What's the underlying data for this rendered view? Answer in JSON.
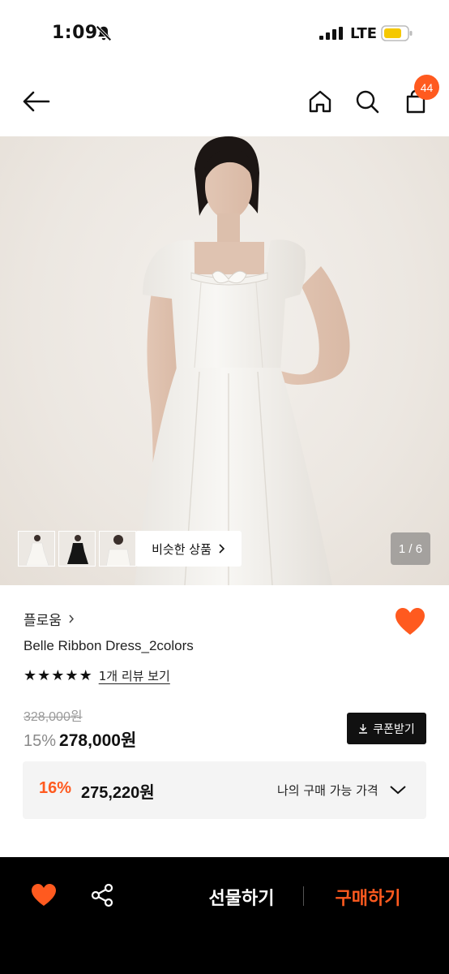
{
  "status_bar": {
    "time": "1:09",
    "network": "LTE"
  },
  "nav": {
    "cart_count": "44"
  },
  "gallery": {
    "similar_label": "비슷한 상품",
    "page_indicator": "1 / 6",
    "current_page": 1,
    "total_pages": 6
  },
  "product": {
    "brand": "플로움",
    "name": "Belle Ribbon Dress_2colors",
    "rating_stars": 5,
    "review_link": "1개 리뷰 보기",
    "original_price": "328,000원",
    "discount": "15%",
    "price": "278,000원",
    "coupon_label": "쿠폰받기"
  },
  "my_price": {
    "discount": "16%",
    "price": "275,220원",
    "label": "나의 구매 가능 가격"
  },
  "bottom_bar": {
    "gift_label": "선물하기",
    "buy_label": "구매하기"
  },
  "colors": {
    "accent": "#ff5a1f",
    "dark": "#111111"
  }
}
